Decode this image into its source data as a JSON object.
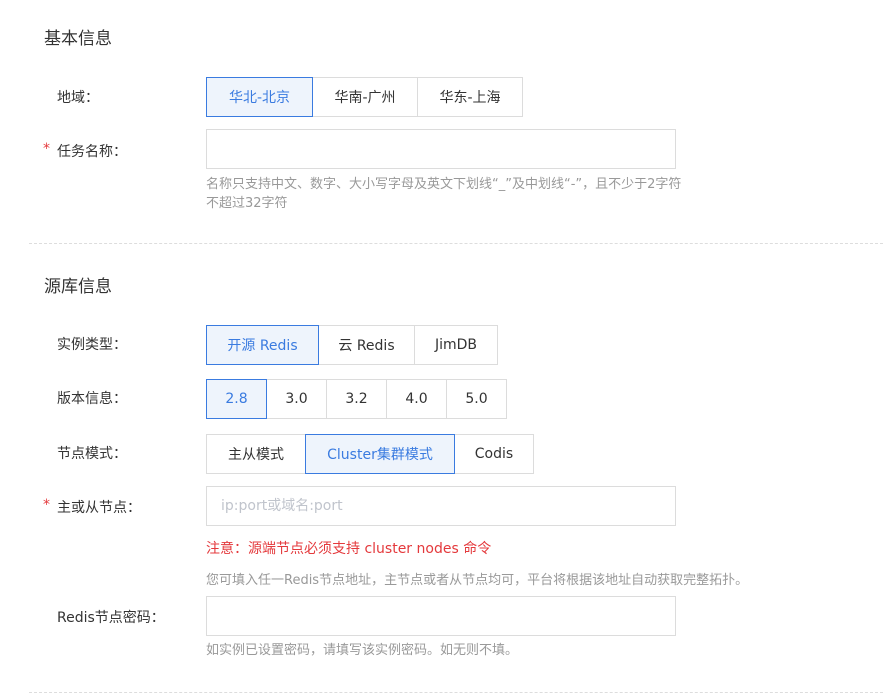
{
  "basic": {
    "title": "基本信息",
    "region": {
      "label": "地域：",
      "options": [
        "华北-北京",
        "华南-广州",
        "华东-上海"
      ],
      "selected": "华北-北京"
    },
    "task_name": {
      "required_mark": "*",
      "label": "任务名称：",
      "value": "",
      "hint_line1": "名称只支持中文、数字、大小写字母及英文下划线“_”及中划线“-”，且不少于2字符",
      "hint_line2": "不超过32字符"
    }
  },
  "source": {
    "title": "源库信息",
    "instance_type": {
      "label": "实例类型：",
      "options": [
        "开源 Redis",
        "云 Redis",
        "JimDB"
      ],
      "selected": "开源 Redis"
    },
    "version": {
      "label": "版本信息：",
      "options": [
        "2.8",
        "3.0",
        "3.2",
        "4.0",
        "5.0"
      ],
      "selected": "2.8"
    },
    "node_mode": {
      "label": "节点模式：",
      "options": [
        "主从模式",
        "Cluster集群模式",
        "Codis"
      ],
      "selected": "Cluster集群模式"
    },
    "node_address": {
      "required_mark": "*",
      "label": "主或从节点：",
      "placeholder": "ip:port或域名:port",
      "value": "",
      "warning": "注意：源端节点必须支持 cluster nodes 命令",
      "hint": "您可填入任一Redis节点地址，主节点或者从节点均可，平台将根据该地址自动获取完整拓扑。"
    },
    "password": {
      "label": "Redis节点密码：",
      "value": "",
      "hint": "如实例已设置密码，请填写该实例密码。如无则不填。"
    }
  },
  "colors": {
    "accent": "#3a7be0",
    "accent_bg": "#eef4fc",
    "required": "#e4393c",
    "hint": "#999999",
    "border": "#dcdcdc"
  }
}
